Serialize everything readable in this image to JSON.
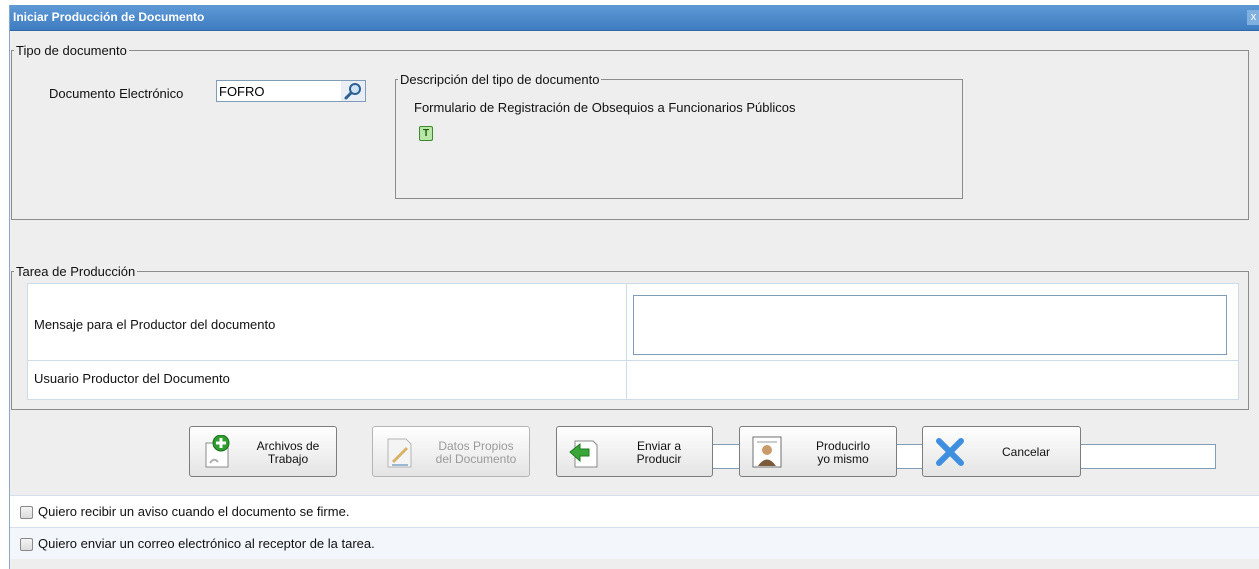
{
  "window": {
    "title": "Iniciar Producción de Documento",
    "close_label": "x"
  },
  "tipo": {
    "legend": "Tipo de documento",
    "doc_label": "Documento Electrónico",
    "doc_value": "FOFRO",
    "desc_legend": "Descripción del tipo de documento",
    "desc_text": "Formulario de Registración de Obsequios a Funcionarios Públicos",
    "type_icon_letter": "T"
  },
  "tarea": {
    "legend": "Tarea de Producción",
    "mensaje_label": "Mensaje para el Productor del documento",
    "mensaje_value": "",
    "usuario_label": "Usuario Productor del Documento",
    "usuario_value": ""
  },
  "buttons": {
    "archivos_line1": "Archivos de",
    "archivos_line2": "Trabajo",
    "datos_line1": "Datos Propios",
    "datos_line2": "del Documento",
    "enviar_line1": "Enviar a",
    "enviar_line2": "Producir",
    "producirlo_line1": "Producirlo",
    "producirlo_line2": "yo mismo",
    "cancelar": "Cancelar"
  },
  "checks": {
    "aviso": "Quiero recibir un aviso cuando el documento se firme.",
    "correo": "Quiero enviar un correo electrónico al receptor de la tarea."
  },
  "colors": {
    "title_bar": "#4a86c8",
    "add_icon": "#2e9e2e",
    "cancel_icon": "#3f8fe0"
  }
}
